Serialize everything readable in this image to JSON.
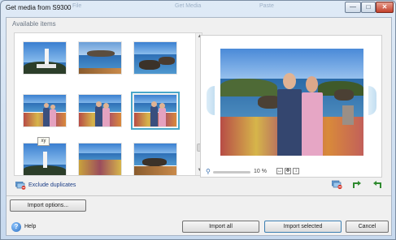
{
  "window": {
    "title": "Get media from S9300",
    "ghost_tabs": [
      "File",
      "Get Media",
      "Paste"
    ],
    "controls": {
      "minimize": "—",
      "maximize": "□",
      "close": "✕"
    }
  },
  "available_items": {
    "label": "Available items",
    "thumbnails": [
      {
        "scene": "lighthouse",
        "selected": false
      },
      {
        "scene": "coast-rocks",
        "selected": false
      },
      {
        "scene": "coast-rocks",
        "selected": false
      },
      {
        "scene": "couple",
        "selected": false
      },
      {
        "scene": "couple",
        "selected": false
      },
      {
        "scene": "couple",
        "selected": true
      },
      {
        "scene": "lighthouse",
        "selected": false
      },
      {
        "scene": "flowers-coast",
        "selected": false
      },
      {
        "scene": "flowers-coast",
        "selected": false
      }
    ],
    "tooltip": "xy"
  },
  "preview": {
    "zoom_value": "10 %",
    "zoom_level": 0.1
  },
  "exclude_duplicates": {
    "label": "Exclude duplicates",
    "icon": "exclude-duplicates-icon"
  },
  "tools": [
    "remove-icon",
    "rotate-left-icon",
    "rotate-right-icon"
  ],
  "buttons": {
    "import_options": "Import options...",
    "import_all": "Import all",
    "import_selected": "Import selected",
    "cancel": "Cancel"
  },
  "help": {
    "label": "Help",
    "icon_glyph": "?"
  }
}
